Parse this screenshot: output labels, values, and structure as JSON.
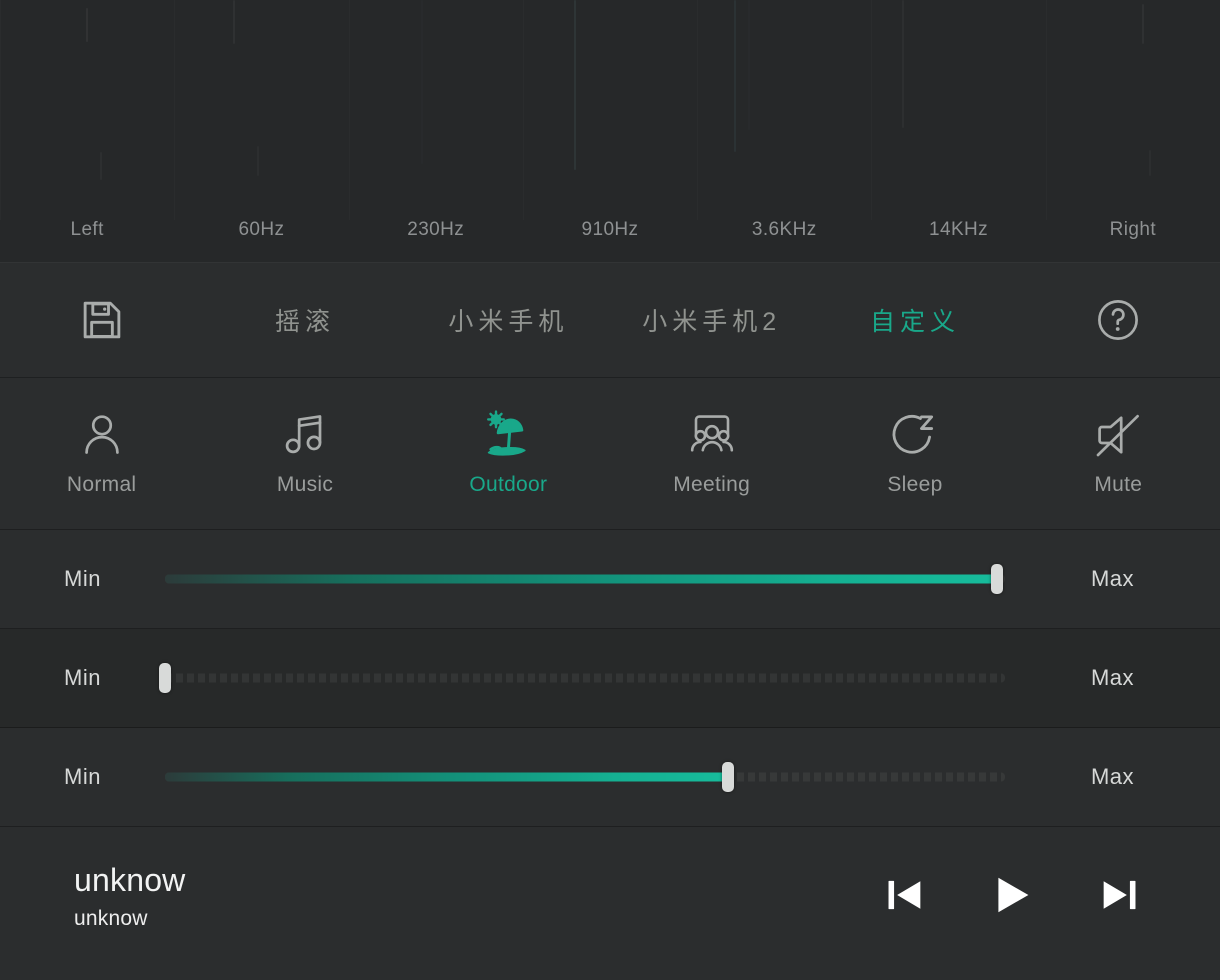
{
  "equalizer": {
    "band_labels": [
      "Left",
      "60Hz",
      "230Hz",
      "910Hz",
      "3.6KHz",
      "14KHz",
      "Right"
    ],
    "bands": [
      {
        "label": "Left",
        "level": 12
      },
      {
        "label": "60Hz",
        "level": 6
      },
      {
        "label": "230Hz",
        "level": 4
      },
      {
        "label": "910Hz",
        "level": 18
      },
      {
        "label": "3.6KHz",
        "level": 22
      },
      {
        "label": "14KHz",
        "level": 9
      },
      {
        "label": "Right",
        "level": 10
      }
    ]
  },
  "presets": {
    "save_icon": "save-floppy-icon",
    "help_icon": "help-circle-icon",
    "items": [
      {
        "label": "摇滚",
        "active": false
      },
      {
        "label": "小米手机",
        "active": false
      },
      {
        "label": "小米手机2",
        "active": false
      },
      {
        "label": "自定义",
        "active": true
      }
    ]
  },
  "modes": {
    "items": [
      {
        "label": "Normal",
        "icon": "person-icon",
        "active": false
      },
      {
        "label": "Music",
        "icon": "music-note-icon",
        "active": false
      },
      {
        "label": "Outdoor",
        "icon": "beach-umbrella-sun-icon",
        "active": true
      },
      {
        "label": "Meeting",
        "icon": "meeting-people-icon",
        "active": false
      },
      {
        "label": "Sleep",
        "icon": "moon-sleep-icon",
        "active": false
      },
      {
        "label": "Mute",
        "icon": "speaker-muted-icon",
        "active": false
      }
    ]
  },
  "sliders": [
    {
      "min_label": "Min",
      "max_label": "Max",
      "value": 99
    },
    {
      "min_label": "Min",
      "max_label": "Max",
      "value": 0
    },
    {
      "min_label": "Min",
      "max_label": "Max",
      "value": 67
    }
  ],
  "player": {
    "title": "unknow",
    "artist": "unknow",
    "prev_icon": "skip-previous-icon",
    "play_icon": "play-icon",
    "next_icon": "skip-next-icon"
  },
  "colors": {
    "accent": "#19a88a",
    "background": "#262829",
    "panel": "#2b2d2e",
    "text_muted": "#90938f",
    "text_primary": "#f2f3f3"
  }
}
